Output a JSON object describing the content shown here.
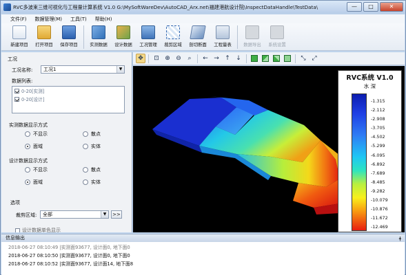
{
  "window": {
    "title": "RVC多波束三维可视化与工程量计算系统 V1.0    G:\\MySoftWareDev\\AutoCAD_Arx.net\\福建港航设计院\\InspectDataHandle\\TestData\\",
    "controls": {
      "minimize": "—",
      "maximize": "□",
      "close": "✕"
    }
  },
  "menu": [
    "文件(F)",
    "数据管理(M)",
    "工具(T)",
    "帮助(H)"
  ],
  "toolbar": [
    {
      "label": "新建项目",
      "icon": "new-project-icon"
    },
    {
      "label": "打开项目",
      "icon": "open-folder-icon"
    },
    {
      "label": "保存项目",
      "icon": "save-disk-icon"
    },
    {
      "label": "实测数据",
      "icon": "measured-data-icon"
    },
    {
      "label": "设计数据",
      "icon": "design-data-icon"
    },
    {
      "label": "工况管理",
      "icon": "workcondition-icon"
    },
    {
      "label": "裁剪区域",
      "icon": "crop-region-icon"
    },
    {
      "label": "剖切断面",
      "icon": "section-cut-icon"
    },
    {
      "label": "工程量表",
      "icon": "quantity-table-icon"
    },
    {
      "label": "数据导出",
      "icon": "export-icon",
      "disabled": true
    },
    {
      "label": "系统设置",
      "icon": "settings-icon",
      "disabled": true
    }
  ],
  "left": {
    "section_workcond": "工况",
    "workcond_label": "工况名称:",
    "workcond_value": "工况1",
    "datalist_label": "数据列表:",
    "datalist": [
      {
        "text": "0-20[实测]",
        "checked": true
      },
      {
        "text": "0-20[设计]",
        "checked": true
      }
    ],
    "measured_display_title": "实测数据显示方式",
    "design_display_title": "设计数据显示方式",
    "display_options": [
      "不显示",
      "散点",
      "面域",
      "实体"
    ],
    "measured_selected": "面域",
    "design_selected": "面域",
    "options_title": "选项",
    "crop_label": "裁剪区域:",
    "crop_value": "全部",
    "crop_button": ">>",
    "partial_check_text": "设计数据单色显示"
  },
  "legend": {
    "title": "RVC系统 V1.0",
    "subtitle": "水 深",
    "values": [
      "-1.315",
      "-2.112",
      "-2.908",
      "-3.705",
      "-4.502",
      "-5.299",
      "-6.095",
      "-6.892",
      "-7.689",
      "-8.485",
      "-9.282",
      "-10.079",
      "-10.876",
      "-11.672",
      "-12.469"
    ]
  },
  "info": {
    "title": "信息输出",
    "pin": "ǂ",
    "lines": [
      "2018-06-27 08:10:49 |实测面93677, 设计面0, 地下面0",
      "2018-06-27 08:10:50 |实测面93677, 设计面0, 地下面0",
      "2018-06-27 08:10:52 |实测面93677, 设计面14, 地下面8"
    ]
  },
  "colors": {
    "accent": "#3568b0",
    "viewport_bg": "#000000"
  }
}
